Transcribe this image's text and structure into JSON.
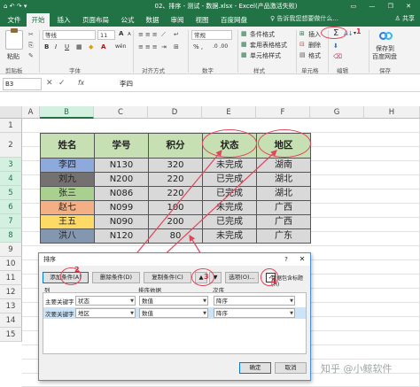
{
  "window": {
    "title": "02、排序 - 测试 - 数据.xlsx - Excel(产品激活失败)",
    "quick_access": "⌂ ↶ ↷ ▾",
    "controls": "▭ — ❐ ✕"
  },
  "menu": {
    "tabs": [
      "文件",
      "开始",
      "插入",
      "页面布局",
      "公式",
      "数据",
      "审阅",
      "视图",
      "百度网盘"
    ],
    "active_index": 1,
    "tell_me": "♀ 告诉我您想要做什么...",
    "share": "♙ 共享"
  },
  "ribbon": {
    "paste": "粘贴",
    "font_name": "等线",
    "font_size": "11",
    "bold": "B",
    "italic": "I",
    "underline": "U",
    "font_grow": "A",
    "font_shrink": "A",
    "wen": "wén",
    "general_format": "常规",
    "pct": "% ,",
    "conditional_format": "条件格式",
    "table_format": "套用表格格式",
    "cell_styles": "单元格样式",
    "insert": "插入",
    "delete": "删除",
    "format": "格式",
    "sum": "Σ",
    "sort_filter": "A↓",
    "find": "▾",
    "save_to_baidu_1": "保存到",
    "save_to_baidu_2": "百度网盘",
    "groups": [
      "剪贴板",
      "字体",
      "对齐方式",
      "数字",
      "样式",
      "单元格",
      "编辑",
      "保存"
    ]
  },
  "formula_bar": {
    "name_box": "B3",
    "fx": "fx",
    "content": "李四"
  },
  "grid": {
    "columns": [
      "A",
      "B",
      "C",
      "D",
      "E",
      "F",
      "G",
      "H"
    ],
    "rows": [
      "1",
      "2",
      "3",
      "4",
      "5",
      "6",
      "7",
      "8",
      "9",
      "10",
      "11",
      "12",
      "13",
      "14",
      "15"
    ]
  },
  "table": {
    "headers": [
      "姓名",
      "学号",
      "积分",
      "状态",
      "地区"
    ],
    "rows": [
      {
        "name": "李四",
        "id": "N130",
        "score": "320",
        "status": "未完成",
        "region": "湖南",
        "color": "#8ea9db"
      },
      {
        "name": "刘九",
        "id": "N200",
        "score": "220",
        "status": "已完成",
        "region": "湖北",
        "color": "#757171"
      },
      {
        "name": "张三",
        "id": "N086",
        "score": "220",
        "status": "已完成",
        "region": "湖北",
        "color": "#a9d08e"
      },
      {
        "name": "赵七",
        "id": "N099",
        "score": "100",
        "status": "未完成",
        "region": "广西",
        "color": "#f4b084"
      },
      {
        "name": "王五",
        "id": "N090",
        "score": "200",
        "status": "已完成",
        "region": "广西",
        "color": "#ffd966"
      },
      {
        "name": "洪八",
        "id": "N120",
        "score": "80",
        "status": "未完成",
        "region": "广东",
        "color": "#8497b0"
      }
    ]
  },
  "dialog": {
    "title": "排序",
    "help": "?",
    "close": "✕",
    "add_level": "添加条件(A)",
    "delete_level": "删除条件(D)",
    "copy_level": "复制条件(C)",
    "up": "▲",
    "down": "▼",
    "options": "选项(O)...",
    "has_headers": "数据包含标题(H)",
    "col_header": "列",
    "sort_on_header": "排序依据",
    "order_header": "次序",
    "primary_label": "主要关键字",
    "primary_value": "状态",
    "primary_sort_on": "数值",
    "primary_order": "降序",
    "secondary_label": "次要关键字",
    "secondary_value": "地区",
    "secondary_sort_on": "数值",
    "secondary_order": "降序",
    "ok": "确定",
    "cancel": "取消"
  },
  "annotations": {
    "step1": "1",
    "step2": "2",
    "step3": "3",
    "step4": "4",
    "accent_color": "#e0455b"
  },
  "watermark": "知乎 @小鲸软件"
}
